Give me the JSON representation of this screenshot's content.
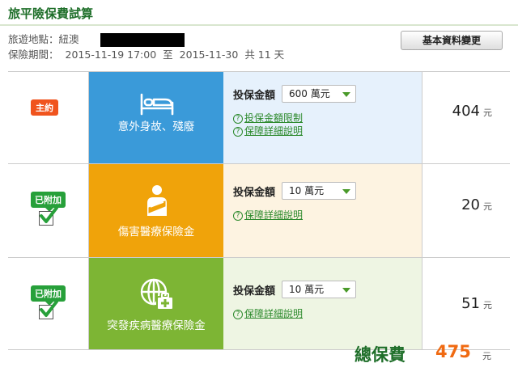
{
  "title": "旅平險保費試算",
  "info": {
    "destination_label": "旅遊地點：紐澳",
    "period_label": "保險期間：",
    "start": "2015-11-19  17:00",
    "to": "至",
    "end": "2015-11-30",
    "days": "共 11 天"
  },
  "basic_button": "基本資料變更",
  "rows": [
    {
      "badge": "主約",
      "icon": "bed-icon",
      "name": "意外身故、殘廢",
      "amount_label": "投保金額",
      "amount": "600 萬元",
      "link1": "投保金額限制",
      "link2": "保障詳細說明",
      "price": "404",
      "unit": "元",
      "color": "#3a9ad9"
    },
    {
      "badge": "已附加",
      "icon": "injured-person-icon",
      "name": "傷害醫療保險金",
      "amount_label": "投保金額",
      "amount": "10 萬元",
      "link2": "保障詳細說明",
      "price": "20",
      "unit": "元",
      "color": "#f0a30a"
    },
    {
      "badge": "已附加",
      "icon": "globe-medical-icon",
      "name": "突發疾病醫療保險金",
      "amount_label": "投保金額",
      "amount": "10 萬元",
      "link2": "保障詳細說明",
      "price": "51",
      "unit": "元",
      "color": "#7db534"
    }
  ],
  "total": {
    "label": "總保費",
    "value": "475",
    "unit": "元"
  }
}
